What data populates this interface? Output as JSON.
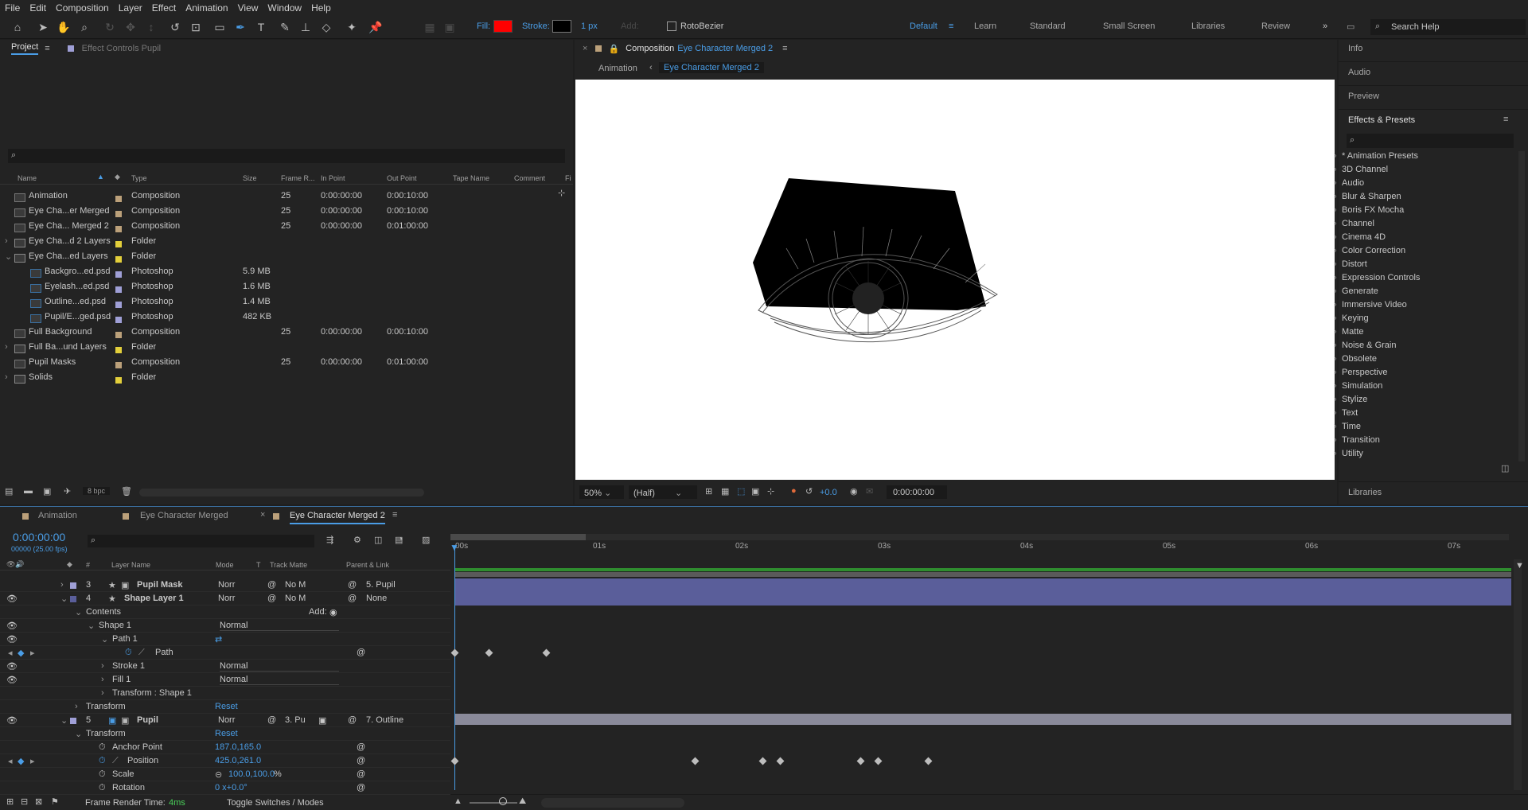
{
  "menu": [
    "File",
    "Edit",
    "Composition",
    "Layer",
    "Effect",
    "Animation",
    "View",
    "Window",
    "Help"
  ],
  "toolbar": {
    "fill_label": "Fill:",
    "stroke_label": "Stroke:",
    "stroke_width": "1 px",
    "add_label": "Add:",
    "rotobezier_label": "RotoBezier",
    "fill_color": "#ff0000"
  },
  "workspaces": [
    "Default",
    "Learn",
    "Standard",
    "Small Screen",
    "Libraries",
    "Review"
  ],
  "search_help": "Search Help",
  "project": {
    "tab": "Project",
    "effect_controls_tab": "Effect Controls Pupil",
    "columns": [
      "Name",
      "Type",
      "Size",
      "Frame R...",
      "In Point",
      "Out Point",
      "Tape Name",
      "Comment",
      "Fi"
    ],
    "rows": [
      {
        "name": "Animation",
        "type": "Composition",
        "size": "",
        "fr": "25",
        "in": "0:00:00:00",
        "out": "0:00:10:00",
        "color": "#bba07a"
      },
      {
        "name": "Eye Cha...er Merged",
        "type": "Composition",
        "size": "",
        "fr": "25",
        "in": "0:00:00:00",
        "out": "0:00:10:00",
        "color": "#bba07a"
      },
      {
        "name": "Eye Cha... Merged 2",
        "type": "Composition",
        "size": "",
        "fr": "25",
        "in": "0:00:00:00",
        "out": "0:01:00:00",
        "color": "#bba07a"
      },
      {
        "name": "Eye Cha...d 2 Layers",
        "type": "Folder",
        "size": "",
        "fr": "",
        "in": "",
        "out": "",
        "color": "#e3cf3b"
      },
      {
        "name": "Eye Cha...ed Layers",
        "type": "Folder",
        "size": "",
        "fr": "",
        "in": "",
        "out": "",
        "color": "#e3cf3b"
      },
      {
        "name": "Backgro...ed.psd",
        "type": "Photoshop",
        "size": "5.9 MB",
        "fr": "",
        "in": "",
        "out": "",
        "color": "#9f9fd6"
      },
      {
        "name": "Eyelash...ed.psd",
        "type": "Photoshop",
        "size": "1.6 MB",
        "fr": "",
        "in": "",
        "out": "",
        "color": "#9f9fd6"
      },
      {
        "name": "Outline...ed.psd",
        "type": "Photoshop",
        "size": "1.4 MB",
        "fr": "",
        "in": "",
        "out": "",
        "color": "#9f9fd6"
      },
      {
        "name": "Pupil/E...ged.psd",
        "type": "Photoshop",
        "size": "482 KB",
        "fr": "",
        "in": "",
        "out": "",
        "color": "#9f9fd6"
      },
      {
        "name": "Full Background",
        "type": "Composition",
        "size": "",
        "fr": "25",
        "in": "0:00:00:00",
        "out": "0:00:10:00",
        "color": "#bba07a"
      },
      {
        "name": "Full Ba...und Layers",
        "type": "Folder",
        "size": "",
        "fr": "",
        "in": "",
        "out": "",
        "color": "#e3cf3b"
      },
      {
        "name": "Pupil Masks",
        "type": "Composition",
        "size": "",
        "fr": "25",
        "in": "0:00:00:00",
        "out": "0:01:00:00",
        "color": "#bba07a"
      },
      {
        "name": "Solids",
        "type": "Folder",
        "size": "",
        "fr": "",
        "in": "",
        "out": "",
        "color": "#e3cf3b"
      }
    ],
    "bpc": "8 bpc"
  },
  "comp": {
    "tab_prefix": "Composition",
    "tab_name": "Eye Character Merged 2",
    "breadcrumb_1": "Animation",
    "breadcrumb_2": "Eye Character Merged 2",
    "zoom": "50%",
    "resolution": "(Half)",
    "exposure": "+0.0",
    "timecode": "0:00:00:00"
  },
  "right": {
    "info": "Info",
    "audio": "Audio",
    "preview": "Preview",
    "effects_title": "Effects & Presets",
    "libraries": "Libraries",
    "effects": [
      "* Animation Presets",
      "3D Channel",
      "Audio",
      "Blur & Sharpen",
      "Boris FX Mocha",
      "Channel",
      "Cinema 4D",
      "Color Correction",
      "Distort",
      "Expression Controls",
      "Generate",
      "Immersive Video",
      "Keying",
      "Matte",
      "Noise & Grain",
      "Obsolete",
      "Perspective",
      "Simulation",
      "Stylize",
      "Text",
      "Time",
      "Transition",
      "Utility"
    ]
  },
  "timeline": {
    "tabs": [
      "Animation",
      "Eye Character Merged",
      "Eye Character Merged 2"
    ],
    "timecode": "0:00:00:00",
    "fps": "00000 (25.00 fps)",
    "col_layer": "Layer Name",
    "col_mode": "Mode",
    "col_t": "T",
    "col_matte": "Track Matte",
    "col_parent": "Parent & Link",
    "col_hash": "#",
    "ruler": [
      "00s",
      "01s",
      "02s",
      "03s",
      "04s",
      "05s",
      "06s",
      "07s"
    ],
    "rows": {
      "l3_num": "3",
      "l3_name": "Pupil Mask",
      "l3_mode": "Norr",
      "l3_matte": "No M",
      "l3_parent": "5. Pupil",
      "l4_num": "4",
      "l4_name": "Shape Layer 1",
      "l4_mode": "Norr",
      "l4_matte": "No M",
      "l4_parent": "None",
      "contents": "Contents",
      "add": "Add:",
      "shape1": "Shape 1",
      "shape1_mode": "Normal",
      "path1": "Path 1",
      "path": "Path",
      "stroke1": "Stroke 1",
      "stroke1_mode": "Normal",
      "fill1": "Fill 1",
      "fill1_mode": "Normal",
      "transform_shape": "Transform : Shape 1",
      "transform": "Transform",
      "reset": "Reset",
      "l5_num": "5",
      "l5_name": "Pupil",
      "l5_mode": "Norr",
      "l5_matte": "3. Pu",
      "l5_parent": "7. Outline",
      "transform2": "Transform",
      "reset2": "Reset",
      "anchor": "Anchor Point",
      "anchor_val": "187.0,165.0",
      "position": "Position",
      "position_val": "425.0,261.0",
      "scale": "Scale",
      "scale_val": "100.0,100.0",
      "scale_unit": "%",
      "rotation": "Rotation",
      "rotation_val": "0 x+0.0°"
    },
    "footer_render": "Frame Render Time:",
    "footer_render_val": "4ms",
    "footer_toggle": "Toggle Switches / Modes"
  }
}
